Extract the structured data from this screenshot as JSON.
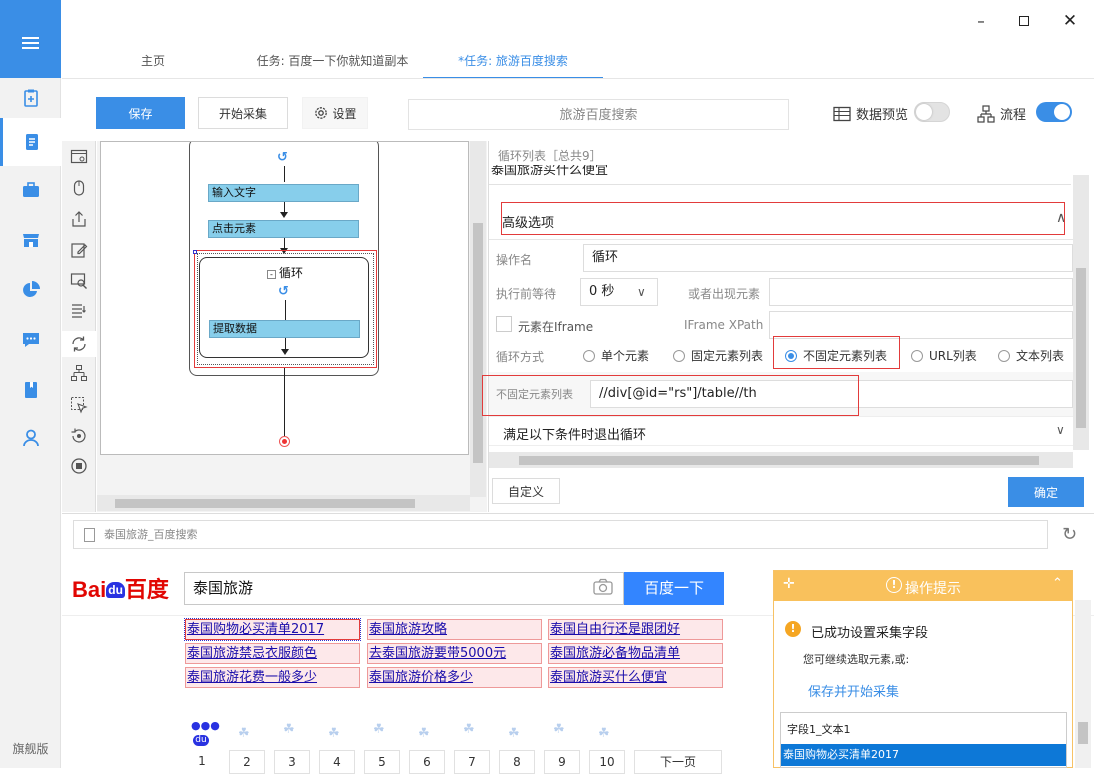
{
  "app": {
    "edition": "旗舰版"
  },
  "sidebar": {
    "items": [
      {
        "name": "new-task",
        "icon": "clipboard-plus-icon"
      },
      {
        "name": "my-tasks",
        "icon": "document-icon"
      },
      {
        "name": "toolbox",
        "icon": "briefcase-icon"
      },
      {
        "name": "store",
        "icon": "store-icon"
      },
      {
        "name": "data",
        "icon": "pie-chart-icon"
      },
      {
        "name": "messages",
        "icon": "message-icon"
      },
      {
        "name": "tutorial",
        "icon": "book-icon"
      },
      {
        "name": "account",
        "icon": "user-icon"
      }
    ]
  },
  "tabs": [
    {
      "label": "主页"
    },
    {
      "label": "任务: 百度一下你就知道副本"
    },
    {
      "label": "*任务: 旅游百度搜索"
    }
  ],
  "toolbar": {
    "save": "保存",
    "start": "开始采集",
    "settings": "设置",
    "task_name": "旅游百度搜索",
    "data_preview": "数据预览",
    "data_preview_on": false,
    "flow": "流程",
    "flow_on": true
  },
  "flow": {
    "nodes": [
      {
        "label": "输入文字"
      },
      {
        "label": "点击元素"
      },
      {
        "label": "循环"
      },
      {
        "label": "提取数据"
      }
    ]
  },
  "loop_panel": {
    "list_title": "循环列表［总共9］",
    "cut_item": "泰国旅游买什么便宜",
    "advanced": "高级选项",
    "op_name_label": "操作名",
    "op_name_value": "循环",
    "wait_label": "执行前等待",
    "wait_value": "0 秒",
    "or_appear_label": "或者出现元素",
    "iframe_checkbox": "元素在Iframe",
    "iframe_xpath_label": "IFrame XPath",
    "loop_mode_label": "循环方式",
    "modes": [
      "单个元素",
      "固定元素列表",
      "不固定元素列表",
      "URL列表",
      "文本列表"
    ],
    "selected_mode": 2,
    "unfixed_list_label": "不固定元素列表",
    "unfixed_list_value": "//div[@id=\"rs\"]/table//th",
    "exit_condition": "满足以下条件时退出循环",
    "custom": "自定义",
    "confirm": "确定"
  },
  "browser": {
    "url_title": "泰国旅游_百度搜索",
    "logo_left": "Bai",
    "logo_du": "du",
    "logo_right": "百度",
    "search_value": "泰国旅游",
    "search_button": "百度一下",
    "suggestions": [
      "泰国购物必买清单2017",
      "泰国旅游攻略",
      "泰国自由行还是跟团好",
      "泰国旅游禁忌衣服颜色",
      "去泰国旅游要带5000元",
      "泰国旅游必备物品清单",
      "泰国旅游花费一般多少",
      "泰国旅游价格多少",
      "泰国旅游买什么便宜"
    ],
    "pager": [
      "1",
      "2",
      "3",
      "4",
      "5",
      "6",
      "7",
      "8",
      "9",
      "10",
      "下一页"
    ],
    "paw_label": "du"
  },
  "hint": {
    "title": "操作提示",
    "success": "已成功设置采集字段",
    "sub": "您可继续选取元素,或:",
    "link": "保存并开始采集",
    "field": "字段1_文本1",
    "field_value": "泰国购物必买清单2017"
  }
}
